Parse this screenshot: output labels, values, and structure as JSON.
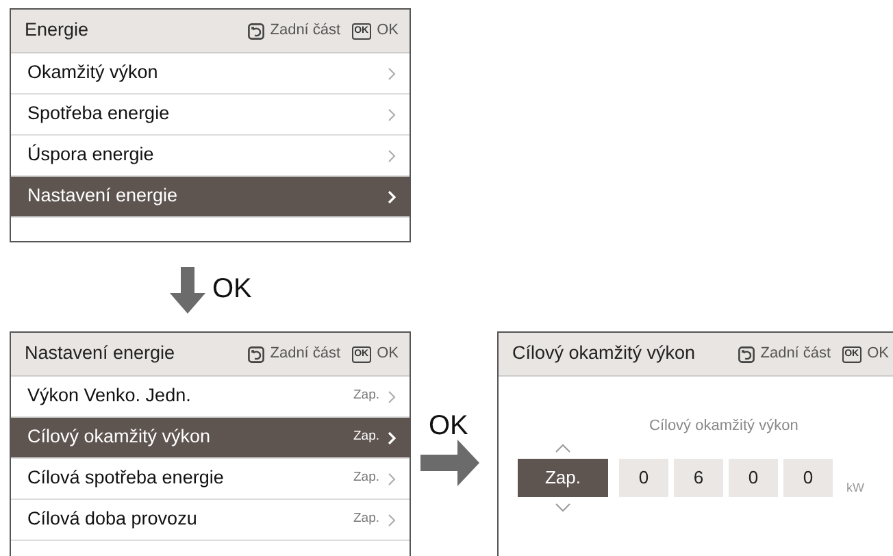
{
  "screens": [
    {
      "kind": "menu",
      "title": "Energie",
      "back_hint": "Zadní část",
      "ok_key": "OK",
      "ok_hint": "OK",
      "items": [
        {
          "label": "Okamžitý výkon",
          "selected": false
        },
        {
          "label": "Spotřeba energie",
          "selected": false
        },
        {
          "label": "Úspora energie",
          "selected": false
        },
        {
          "label": "Nastavení energie",
          "selected": true
        }
      ]
    },
    {
      "kind": "menu",
      "title": "Nastavení energie",
      "back_hint": "Zadní část",
      "ok_key": "OK",
      "ok_hint": "OK",
      "items": [
        {
          "label": "Výkon Venko. Jedn.",
          "value": "Zap.",
          "selected": false
        },
        {
          "label": "Cílový okamžitý výkon",
          "value": "Zap.",
          "selected": true
        },
        {
          "label": "Cílová spotřeba energie",
          "value": "Zap.",
          "selected": false
        },
        {
          "label": "Cílová doba provozu",
          "value": "Zap.",
          "selected": false
        }
      ]
    },
    {
      "kind": "setting",
      "title": "Cílový okamžitý výkon",
      "back_hint": "Zadní část",
      "ok_key": "OK",
      "ok_hint": "OK",
      "caption": "Cílový okamžitý výkon",
      "mode": "Zap.",
      "digits": [
        "0",
        "6",
        "0",
        "0"
      ],
      "unit": "kW"
    }
  ],
  "transitions": [
    {
      "kind": "down",
      "label": "OK"
    },
    {
      "kind": "right",
      "label": "OK"
    }
  ]
}
